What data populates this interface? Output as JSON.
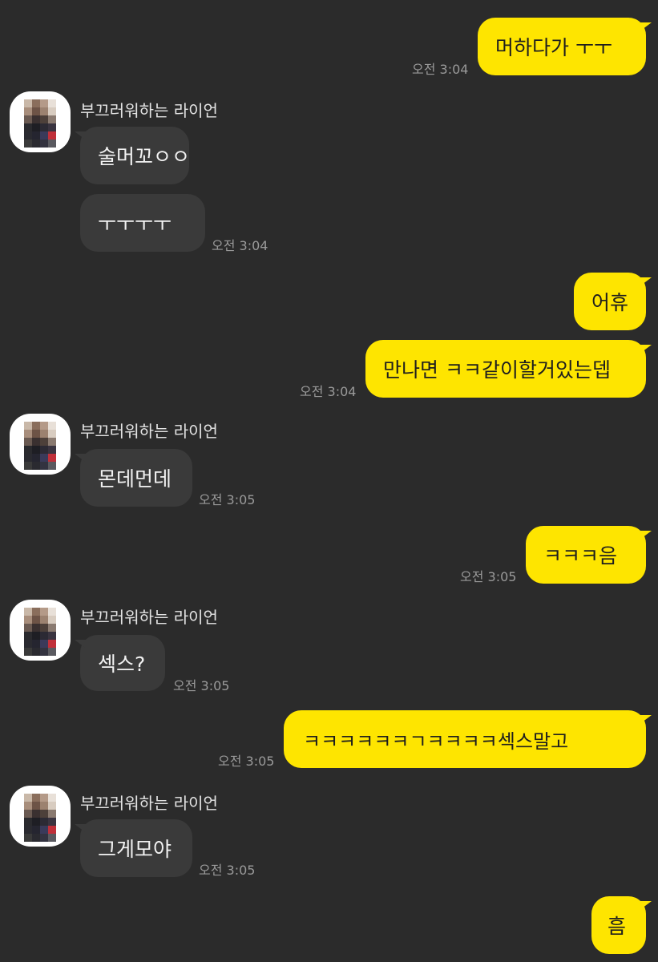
{
  "contact_name": "부끄러워하는 라이언",
  "messages": [
    {
      "text": "머하다가 ㅜㅜ",
      "time": "오전 3:04"
    },
    {
      "text": "술머꼬ㅇㅇ"
    },
    {
      "text": "ㅜㅜㅜㅜ",
      "time": "오전 3:04"
    },
    {
      "text": "어휴"
    },
    {
      "text": "만나면 ㅋㅋ같이할거있는뎁",
      "time": "오전 3:04"
    },
    {
      "text": "몬데먼데",
      "time": "오전 3:05"
    },
    {
      "text": "ㅋㅋㅋ음",
      "time": "오전 3:05"
    },
    {
      "text": "섹스?",
      "time": "오전 3:05"
    },
    {
      "text": "ㅋㅋㅋㅋㅋㅋㄱㅋㅋㅋㅋ섹스말고",
      "time": "오전 3:05"
    },
    {
      "text": "그게모야",
      "time": "오전 3:05"
    },
    {
      "text": "흠"
    }
  ],
  "colors": {
    "background": "#2b2b2b",
    "my_bubble": "#fee500",
    "their_bubble": "#3a3a3a",
    "timestamp": "#9a9a9a"
  },
  "icons": {
    "avatar": "pixelated-profile-photo"
  }
}
